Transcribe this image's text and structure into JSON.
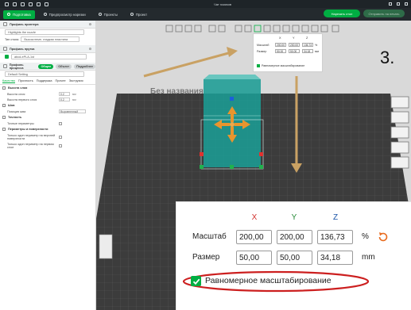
{
  "titlebar": {
    "title": "Чат эскизов",
    "window": [
      "minimize",
      "maximize",
      "close"
    ]
  },
  "tabs": [
    {
      "label": "Подготовка",
      "active": true
    },
    {
      "label": "Предпросмотр нарезки",
      "active": false
    },
    {
      "label": "Проекты",
      "active": false
    },
    {
      "label": "Проект",
      "active": false
    }
  ],
  "actions": {
    "slice": "Нарезать стол",
    "print": "Отправить на печать"
  },
  "sidebar": {
    "printer_section": "Профиль принтера",
    "printer_name": "Highlights the nozzle",
    "plate_label": "Тип стола",
    "plate_value": "Высокотемп. гладкая пластина",
    "filament_section": "Профиль прутка",
    "filament_value": "abcd-ePLA-1st",
    "process_section": "Профиль процесса",
    "process_pills": [
      "Общее",
      "Объект",
      "Подробнее"
    ],
    "process_value": "Default Setting",
    "subtabs": [
      "Качество",
      "Прочность",
      "Поддержка",
      "Прочее",
      "Экструзия"
    ],
    "groups": [
      {
        "title": "Высота слоя",
        "params": [
          {
            "label": "Высота слоя",
            "value": "0.2",
            "unit": "мм"
          },
          {
            "label": "Высота первого слоя",
            "value": "0.2",
            "unit": "мм"
          }
        ]
      },
      {
        "title": "Шов",
        "params": [
          {
            "label": "Позиция шва",
            "select": "Выровненный"
          }
        ]
      },
      {
        "title": "Точность",
        "params": [
          {
            "label": "Точные периметры",
            "checkbox": true
          }
        ]
      },
      {
        "title": "Периметры и поверхности",
        "params": [
          {
            "label": "Только один периметр на верхней поверхности",
            "checkbox": true
          },
          {
            "label": "Только один периметр на первом слое",
            "checkbox": true
          }
        ]
      }
    ]
  },
  "viewport": {
    "plate_text": "Без названия",
    "object_color": "#1b9c94",
    "arrow_color": "#c9a163",
    "handle_colors": {
      "x": "#e0322f",
      "y": "#22b14c",
      "z": "#1c5fd9"
    }
  },
  "mini_panel": {
    "axes": [
      "X",
      "Y",
      "Z"
    ],
    "scale_label": "Масштаб",
    "size_label": "Размер",
    "scale": [
      "200.00",
      "200.00",
      "136.73"
    ],
    "size": [
      "50.00",
      "50.00",
      "34.18"
    ],
    "scale_unit": "%",
    "size_unit": "мм",
    "uniform_label": "Равномерное масштабирование"
  },
  "zoom_panel": {
    "axes": [
      "X",
      "Y",
      "Z"
    ],
    "axis_colors": [
      "#d0312d",
      "#2a8c3a",
      "#1a55a8"
    ],
    "scale_label": "Масштаб",
    "size_label": "Размер",
    "scale": [
      "200,00",
      "200,00",
      "136,73"
    ],
    "size": [
      "50,00",
      "50,00",
      "34,18"
    ],
    "scale_unit": "%",
    "size_unit": "mm",
    "uniform_label": "Равномерное масштабирование",
    "uniform_checked": true,
    "reset_icon_color": "#e86b1e",
    "highlight_color": "#cc1f1f"
  },
  "step_label": "3."
}
